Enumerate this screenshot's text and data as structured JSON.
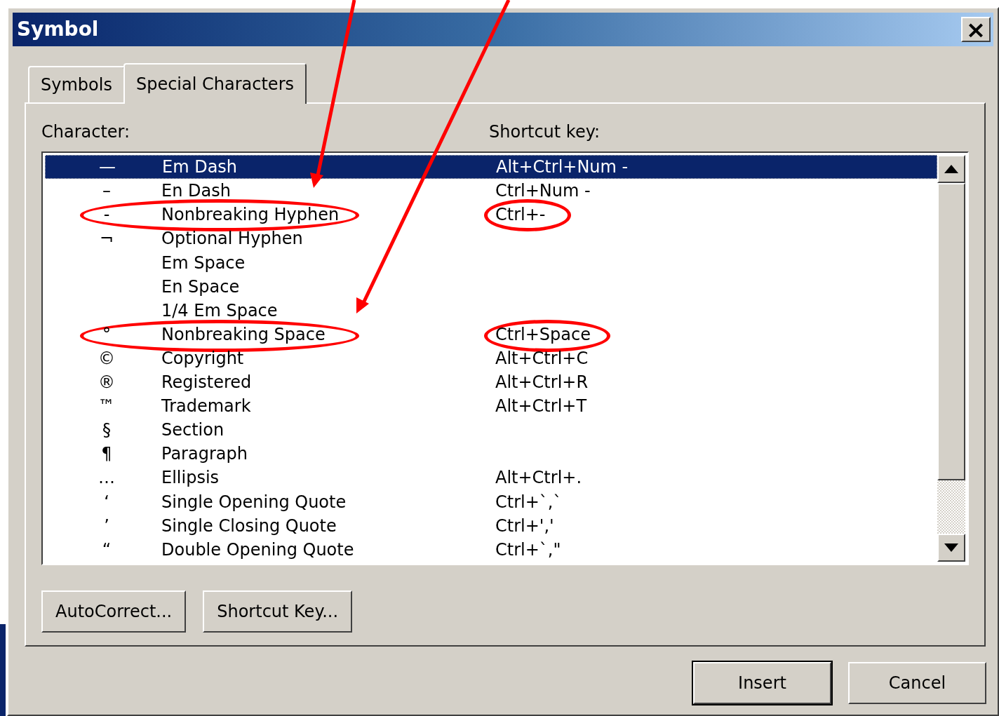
{
  "window": {
    "title": "Symbol",
    "close": "×"
  },
  "tabs": [
    {
      "label": "Symbols",
      "selected": false
    },
    {
      "label": "Special Characters",
      "selected": true
    }
  ],
  "columns": {
    "character": "Character:",
    "shortcut": "Shortcut key:"
  },
  "rows": [
    {
      "char": "—",
      "name": "Em Dash",
      "shortcut": "Alt+Ctrl+Num -",
      "selected": true,
      "circled": false
    },
    {
      "char": "–",
      "name": "En Dash",
      "shortcut": "Ctrl+Num -",
      "selected": false,
      "circled": false
    },
    {
      "char": "-",
      "name": "Nonbreaking Hyphen",
      "shortcut": "Ctrl+-",
      "selected": false,
      "circled": true
    },
    {
      "char": "¬",
      "name": "Optional Hyphen",
      "selected": false,
      "circled": false
    },
    {
      "name": "Em Space",
      "selected": false,
      "circled": false
    },
    {
      "name": "En Space",
      "selected": false,
      "circled": false
    },
    {
      "name": "1/4 Em Space",
      "selected": false,
      "circled": false
    },
    {
      "char": "°",
      "name": "Nonbreaking Space",
      "shortcut": "Ctrl+Space",
      "selected": false,
      "circled": true
    },
    {
      "char": "©",
      "name": "Copyright",
      "shortcut": "Alt+Ctrl+C",
      "selected": false,
      "circled": false
    },
    {
      "char": "®",
      "name": "Registered",
      "shortcut": "Alt+Ctrl+R",
      "selected": false,
      "circled": false
    },
    {
      "char": "™",
      "name": "Trademark",
      "shortcut": "Alt+Ctrl+T",
      "selected": false,
      "circled": false
    },
    {
      "char": "§",
      "name": "Section",
      "selected": false,
      "circled": false
    },
    {
      "char": "¶",
      "name": "Paragraph",
      "selected": false,
      "circled": false
    },
    {
      "char": "…",
      "name": "Ellipsis",
      "shortcut": "Alt+Ctrl+.",
      "selected": false,
      "circled": false
    },
    {
      "char": "‘",
      "name": "Single Opening Quote",
      "shortcut": "Ctrl+`,`",
      "selected": false,
      "circled": false
    },
    {
      "char": "’",
      "name": "Single Closing Quote",
      "shortcut": "Ctrl+','",
      "selected": false,
      "circled": false
    },
    {
      "char": "“",
      "name": "Double Opening Quote",
      "shortcut": "Ctrl+`,\"",
      "selected": false,
      "circled": false
    }
  ],
  "panel_buttons": [
    "AutoCorrect...",
    "Shortcut Key..."
  ],
  "dialog_buttons": [
    {
      "label": "Insert",
      "default": true
    },
    {
      "label": "Cancel",
      "default": false
    }
  ]
}
